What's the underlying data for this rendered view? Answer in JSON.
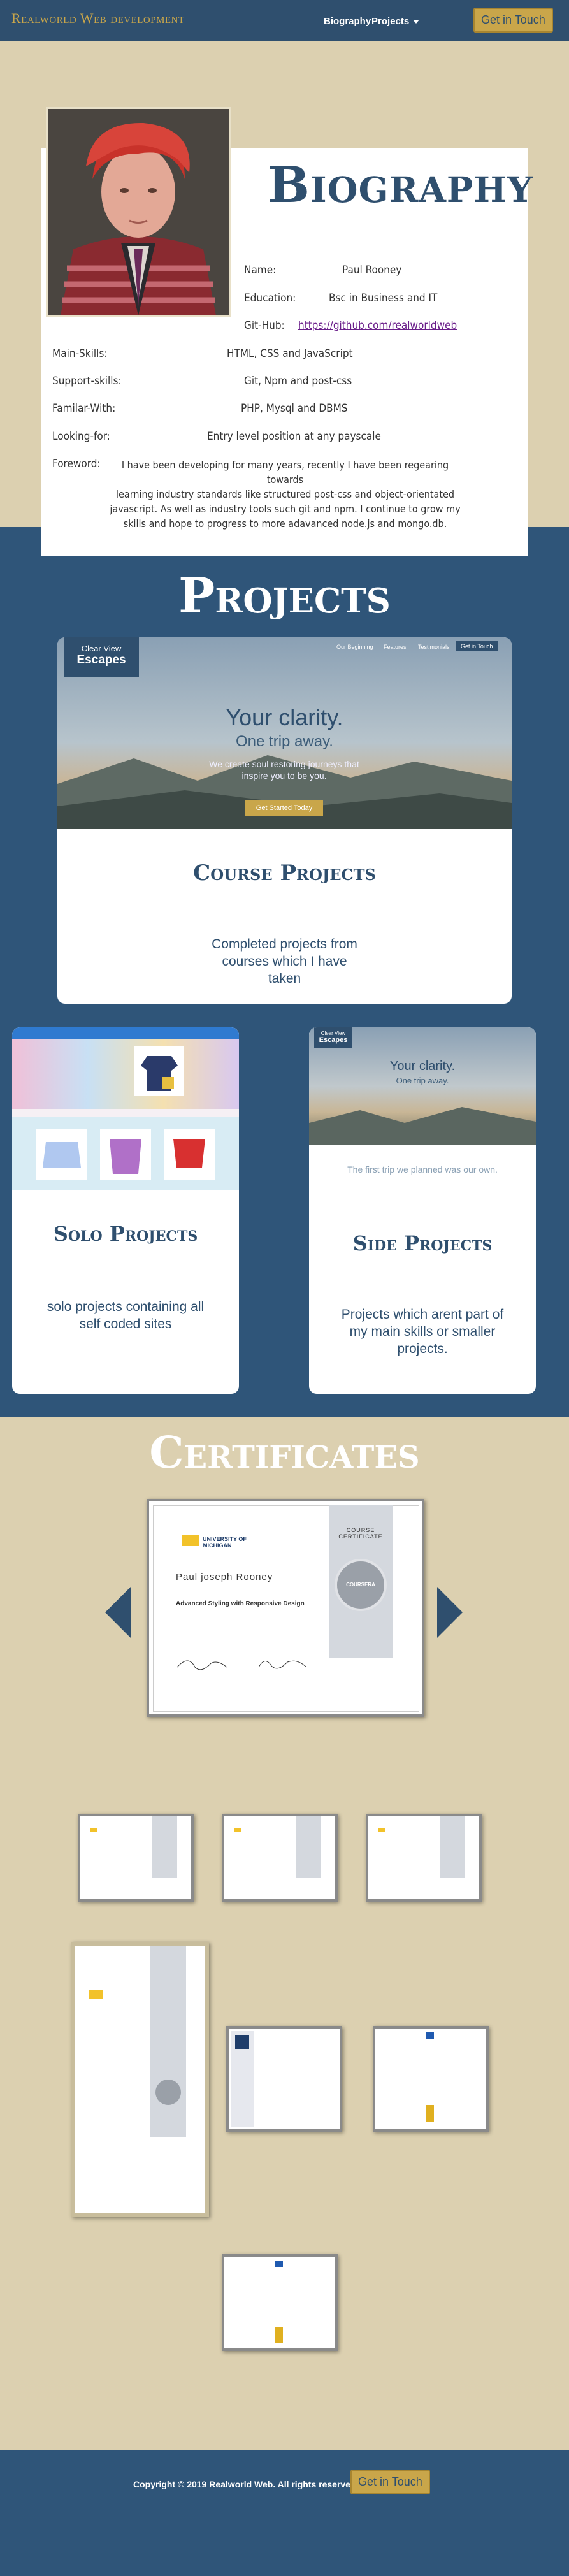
{
  "nav": {
    "brand": "Realworld Web development",
    "links": [
      "Biography",
      "Projects"
    ],
    "cta": "Get in Touch"
  },
  "bio": {
    "title": "Biography",
    "fields": [
      {
        "label": "Name:",
        "value": "Paul Rooney"
      },
      {
        "label": "Education:",
        "value": "Bsc in Business and IT"
      },
      {
        "label": "Git-Hub:",
        "value": "https://github.com/realworldweb"
      }
    ],
    "skills": [
      {
        "label": "Main-Skills:",
        "value": "HTML, CSS and JavaScript"
      },
      {
        "label": "Support-skills:",
        "value": "Git, Npm and post-css"
      },
      {
        "label": "Familar-With:",
        "value": "PHP, Mysql and DBMS"
      },
      {
        "label": "Looking-for:",
        "value": "Entry level position at any payscale"
      }
    ],
    "foreword_label": "Foreword:",
    "foreword_lines": [
      "I have been developing for many years, recently I have been regearing towards",
      "learning industry standards like structured post-css and object-orientated",
      "javascript. As well as industry tools such git and npm. I continue to grow my",
      "skills and hope to progress to more adavanced node.js and mongo.db."
    ]
  },
  "projects": {
    "title": "Projects",
    "course": {
      "title": "Course Projects",
      "desc": "Completed projects from courses which I have taken",
      "preview": {
        "logo_top": "Clear View",
        "logo_bottom": "Escapes",
        "nav": [
          "Our Beginning",
          "Features",
          "Testimonials",
          "Get in Touch"
        ],
        "headline": "Your clarity.",
        "sub": "One trip away.",
        "body": "We create soul restoring journeys that inspire you to be you.",
        "button": "Get Started Today"
      }
    },
    "solo": {
      "title": "Solo Projects",
      "desc": "solo projects containing all self coded sites"
    },
    "side": {
      "title": "Side Projects",
      "desc": "Projects which arent part of my main skills or smaller projects.",
      "preview": {
        "logo_top": "Clear View",
        "logo_bottom": "Escapes",
        "headline": "Your clarity.",
        "sub": "One trip away.",
        "tagline": "The first trip we planned was our own."
      }
    }
  },
  "certificates": {
    "title": "Certificates",
    "main": {
      "university": "UNIVERSITY OF MICHIGAN",
      "ribbon": "COURSE CERTIFICATE",
      "name": "Paul joseph Rooney",
      "course": "Advanced Styling with Responsive Design",
      "seal": "COURSERA"
    }
  },
  "footer": {
    "copyright": "Copyright © 2019 Realworld Web. All rights reserved.",
    "cta": "Get in Touch"
  },
  "colors": {
    "navy": "#2f4f6e",
    "gold": "#c9a64a",
    "sand": "#dcd0b0",
    "band": "#2f5579"
  }
}
